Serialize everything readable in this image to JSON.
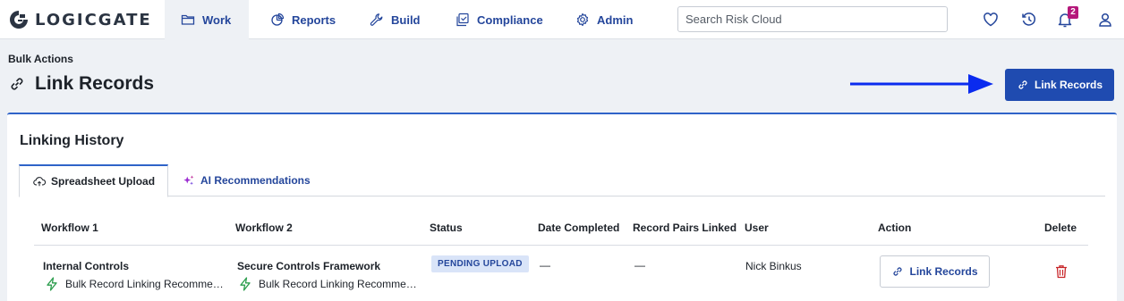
{
  "brand": {
    "name": "LOGICGATE"
  },
  "nav": {
    "items": [
      {
        "label": "Work",
        "icon": "folder-icon",
        "active": true
      },
      {
        "label": "Reports",
        "icon": "pie-chart-icon"
      },
      {
        "label": "Build",
        "icon": "wrench-icon"
      },
      {
        "label": "Compliance",
        "icon": "copy-check-icon"
      },
      {
        "label": "Admin",
        "icon": "gear-icon"
      }
    ],
    "search_placeholder": "Search Risk Cloud",
    "notifications_count": "2",
    "right_icons": [
      "heart-icon",
      "history-icon",
      "bell-icon",
      "user-icon"
    ]
  },
  "header": {
    "breadcrumb": "Bulk Actions",
    "title": "Link Records",
    "primary_button": "Link Records",
    "annotation_color": "#0a2bef"
  },
  "card": {
    "title": "Linking History",
    "tabs": [
      {
        "label": "Spreadsheet Upload",
        "icon": "cloud-upload-icon",
        "active": true
      },
      {
        "label": "AI Recommendations",
        "icon": "sparkle-icon"
      }
    ],
    "table": {
      "columns": [
        "Workflow 1",
        "Workflow 2",
        "Status",
        "Date Completed",
        "Record Pairs Linked",
        "User",
        "Action",
        "Delete"
      ],
      "rows": [
        {
          "workflow1": {
            "name": "Internal Controls",
            "sub": "Bulk Record Linking Recomme…"
          },
          "workflow2": {
            "name": "Secure Controls Framework",
            "sub": "Bulk Record Linking Recomme…"
          },
          "status": "PENDING UPLOAD",
          "date_completed": "—",
          "record_pairs_linked": "—",
          "user": "Nick Binkus",
          "action": "Link Records"
        }
      ]
    }
  },
  "colors": {
    "primary": "#1f4bb0",
    "link": "#24469b",
    "badge": "#b5177a",
    "delete": "#c8262a"
  }
}
